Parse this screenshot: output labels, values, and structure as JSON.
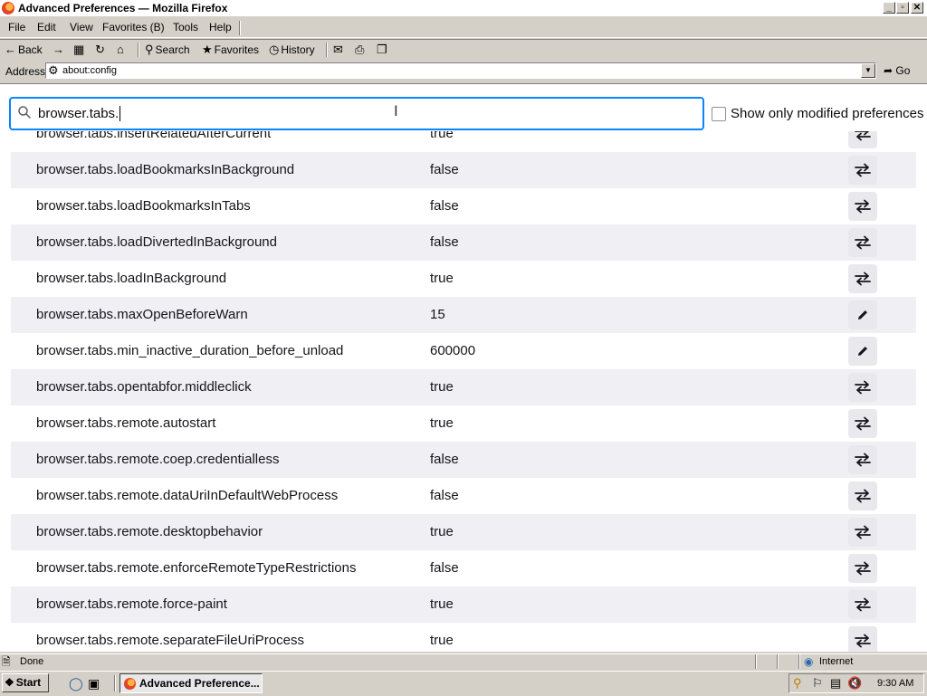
{
  "window": {
    "title": "Advanced Preferences — Mozilla Firefox",
    "min_glyph": "_",
    "max_glyph": "▫",
    "close_glyph": "✕"
  },
  "menu": {
    "items": [
      "File",
      "Edit",
      "View",
      "Favorites (B)",
      "Tools",
      "Help"
    ]
  },
  "toolbar": {
    "back": "Back",
    "search": "Search",
    "favorites": "Favorites",
    "history": "History"
  },
  "address": {
    "label": "Address",
    "value": "about:config",
    "go": "Go"
  },
  "search": {
    "value": "browser.tabs.",
    "show_modified_label": "Show only modified preferences",
    "show_modified_checked": false
  },
  "prefs": [
    {
      "name": "browser.tabs.insertRelatedAfterCurrent",
      "value": "true",
      "action": "toggle"
    },
    {
      "name": "browser.tabs.loadBookmarksInBackground",
      "value": "false",
      "action": "toggle"
    },
    {
      "name": "browser.tabs.loadBookmarksInTabs",
      "value": "false",
      "action": "toggle"
    },
    {
      "name": "browser.tabs.loadDivertedInBackground",
      "value": "false",
      "action": "toggle"
    },
    {
      "name": "browser.tabs.loadInBackground",
      "value": "true",
      "action": "toggle"
    },
    {
      "name": "browser.tabs.maxOpenBeforeWarn",
      "value": "15",
      "action": "edit"
    },
    {
      "name": "browser.tabs.min_inactive_duration_before_unload",
      "value": "600000",
      "action": "edit"
    },
    {
      "name": "browser.tabs.opentabfor.middleclick",
      "value": "true",
      "action": "toggle"
    },
    {
      "name": "browser.tabs.remote.autostart",
      "value": "true",
      "action": "toggle"
    },
    {
      "name": "browser.tabs.remote.coep.credentialless",
      "value": "false",
      "action": "toggle"
    },
    {
      "name": "browser.tabs.remote.dataUriInDefaultWebProcess",
      "value": "false",
      "action": "toggle"
    },
    {
      "name": "browser.tabs.remote.desktopbehavior",
      "value": "true",
      "action": "toggle"
    },
    {
      "name": "browser.tabs.remote.enforceRemoteTypeRestrictions",
      "value": "false",
      "action": "toggle"
    },
    {
      "name": "browser.tabs.remote.force-paint",
      "value": "true",
      "action": "toggle"
    },
    {
      "name": "browser.tabs.remote.separateFileUriProcess",
      "value": "true",
      "action": "toggle"
    }
  ],
  "status": {
    "text": "Done",
    "zone": "Internet"
  },
  "taskbar": {
    "start": "Start",
    "task": "Advanced Preference...",
    "clock": "9:30 AM"
  },
  "colors": {
    "accent": "#0a84ff",
    "row_alt": "#f0f0f4",
    "button_bg": "#e9e9ed"
  }
}
